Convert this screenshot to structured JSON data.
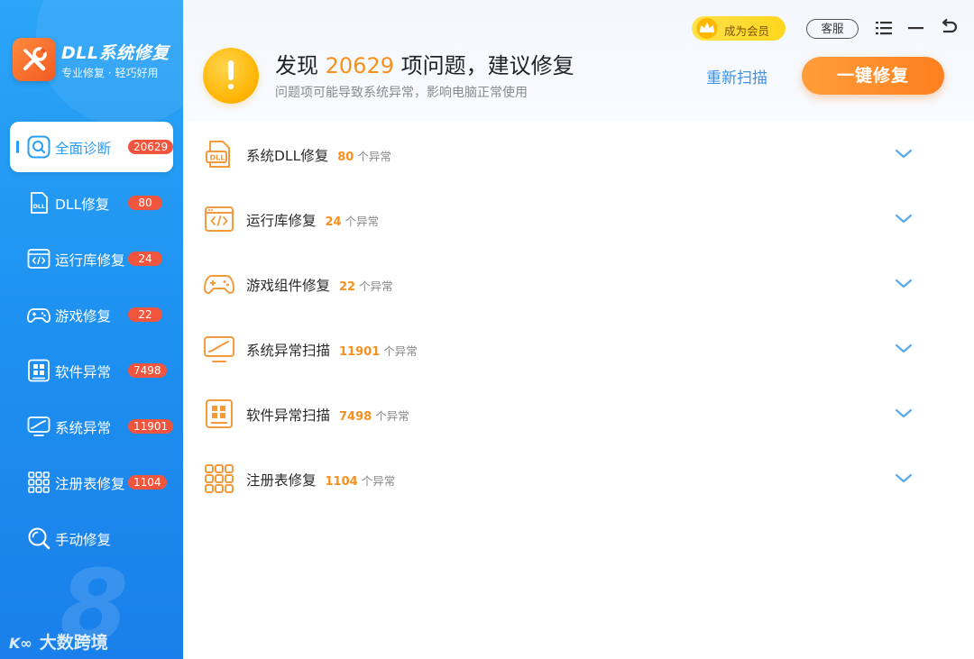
{
  "app": {
    "title": "DLL系统修复",
    "subtitle": "专业修复 · 轻巧好用"
  },
  "colors": {
    "sidebar": "#1d8ff0",
    "accent_orange": "#f8901e",
    "badge_red": "#f2553d",
    "link_blue": "#3b93e8"
  },
  "sidebar": {
    "items": [
      {
        "label": "全面诊断",
        "badge": "20629",
        "icon": "search-icon",
        "active": true
      },
      {
        "label": "DLL修复",
        "badge": "80",
        "icon": "dll-file-icon"
      },
      {
        "label": "运行库修复",
        "badge": "24",
        "icon": "code-window-icon"
      },
      {
        "label": "游戏修复",
        "badge": "22",
        "icon": "gamepad-icon"
      },
      {
        "label": "软件异常",
        "badge": "7498",
        "icon": "app-grid-icon"
      },
      {
        "label": "系统异常",
        "badge": "11901",
        "icon": "monitor-chart-icon"
      },
      {
        "label": "注册表修复",
        "badge": "1104",
        "icon": "registry-grid-icon"
      },
      {
        "label": "手动修复",
        "badge": "",
        "icon": "manual-search-icon"
      }
    ],
    "watermark": {
      "digit": "8",
      "brand": "大数跨境"
    }
  },
  "topbar": {
    "vip_label": "成为会员",
    "service_label": "客服"
  },
  "summary": {
    "prefix": "发现",
    "count": "20629",
    "suffix": "项问题，建议修复",
    "description": "问题项可能导致系统异常，影响电脑正常使用",
    "rescan_label": "重新扫描",
    "fix_label": "一键修复"
  },
  "categories": [
    {
      "label": "系统DLL修复",
      "count": "80",
      "unit": "个异常",
      "icon": "dll-file-icon"
    },
    {
      "label": "运行库修复",
      "count": "24",
      "unit": "个异常",
      "icon": "code-window-icon"
    },
    {
      "label": "游戏组件修复",
      "count": "22",
      "unit": "个异常",
      "icon": "gamepad-icon"
    },
    {
      "label": "系统异常扫描",
      "count": "11901",
      "unit": "个异常",
      "icon": "monitor-chart-icon"
    },
    {
      "label": "软件异常扫描",
      "count": "7498",
      "unit": "个异常",
      "icon": "app-grid-icon"
    },
    {
      "label": "注册表修复",
      "count": "1104",
      "unit": "个异常",
      "icon": "registry-grid-icon"
    }
  ]
}
